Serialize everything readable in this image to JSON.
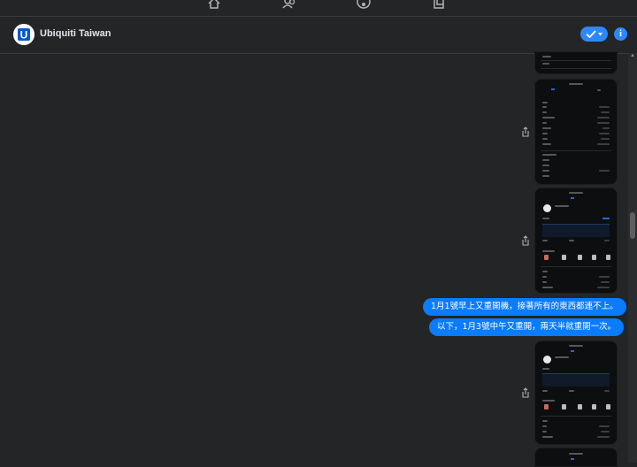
{
  "header": {
    "title": "Ubiquiti Taiwan",
    "avatar_logo_letter": "U",
    "info_label": "i"
  },
  "messages": [
    "1月1號早上又重開機，接著所有的東西都連不上。",
    "以下，1月3號中午又重開，兩天半就重開一次。"
  ],
  "colors": {
    "accent": "#2d88ff",
    "bubble": "#0a7cff",
    "background": "#242526"
  },
  "icons": [
    "home-icon",
    "friends-icon",
    "marketplace-icon",
    "pages-icon",
    "share-icon",
    "check-icon",
    "info-icon"
  ]
}
